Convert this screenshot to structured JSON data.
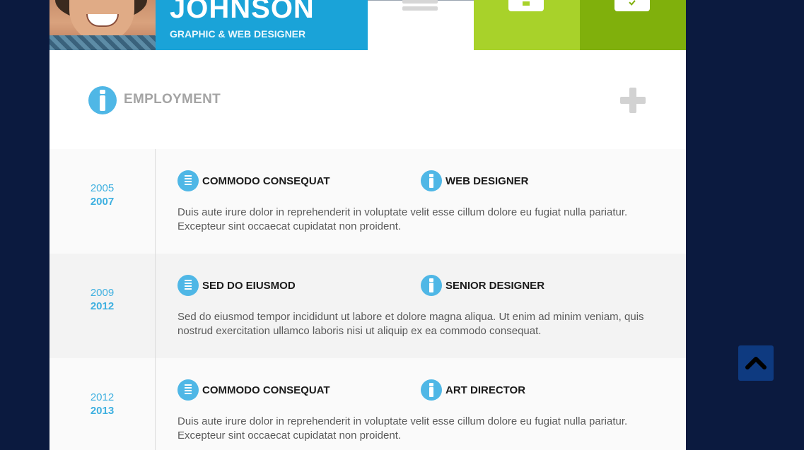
{
  "header": {
    "name": "JOHNSON",
    "role": "GRAPHIC & WEB DESIGNER"
  },
  "icons": {
    "menu": "menu-icon",
    "briefcase": "briefcase-icon",
    "check": "check-icon",
    "info": "info-icon",
    "building": "building-icon",
    "plus": "plus-icon",
    "scroll_top": "chevron-up-icon"
  },
  "colors": {
    "background": "#0b1a3f",
    "accent_blue": "#1aa3d8",
    "icon_blue": "#4fb7e6",
    "green_light": "#a8d22a",
    "green_dark": "#80b00c",
    "scroll_button": "#0e3a80"
  },
  "section": {
    "title": "EMPLOYMENT"
  },
  "employment": [
    {
      "start": "2005",
      "end": "2007",
      "company": "COMMODO CONSEQUAT",
      "position": "WEB DESIGNER",
      "description": "Duis aute irure dolor in reprehenderit in voluptate velit esse cillum dolore eu fugiat nulla pariatur. Excepteur sint occaecat cupidatat non proident."
    },
    {
      "start": "2009",
      "end": "2012",
      "company": "SED DO EIUSMOD",
      "position": "SENIOR DESIGNER",
      "description": "Sed do eiusmod tempor incididunt ut labore et dolore magna aliqua. Ut enim ad minim veniam, quis nostrud exercitation ullamco laboris nisi ut aliquip ex ea commodo consequat."
    },
    {
      "start": "2012",
      "end": "2013",
      "company": "COMMODO CONSEQUAT",
      "position": "ART DIRECTOR",
      "description": "Duis aute irure dolor in reprehenderit in voluptate velit esse cillum dolore eu fugiat nulla pariatur. Excepteur sint occaecat cupidatat non proident."
    }
  ]
}
